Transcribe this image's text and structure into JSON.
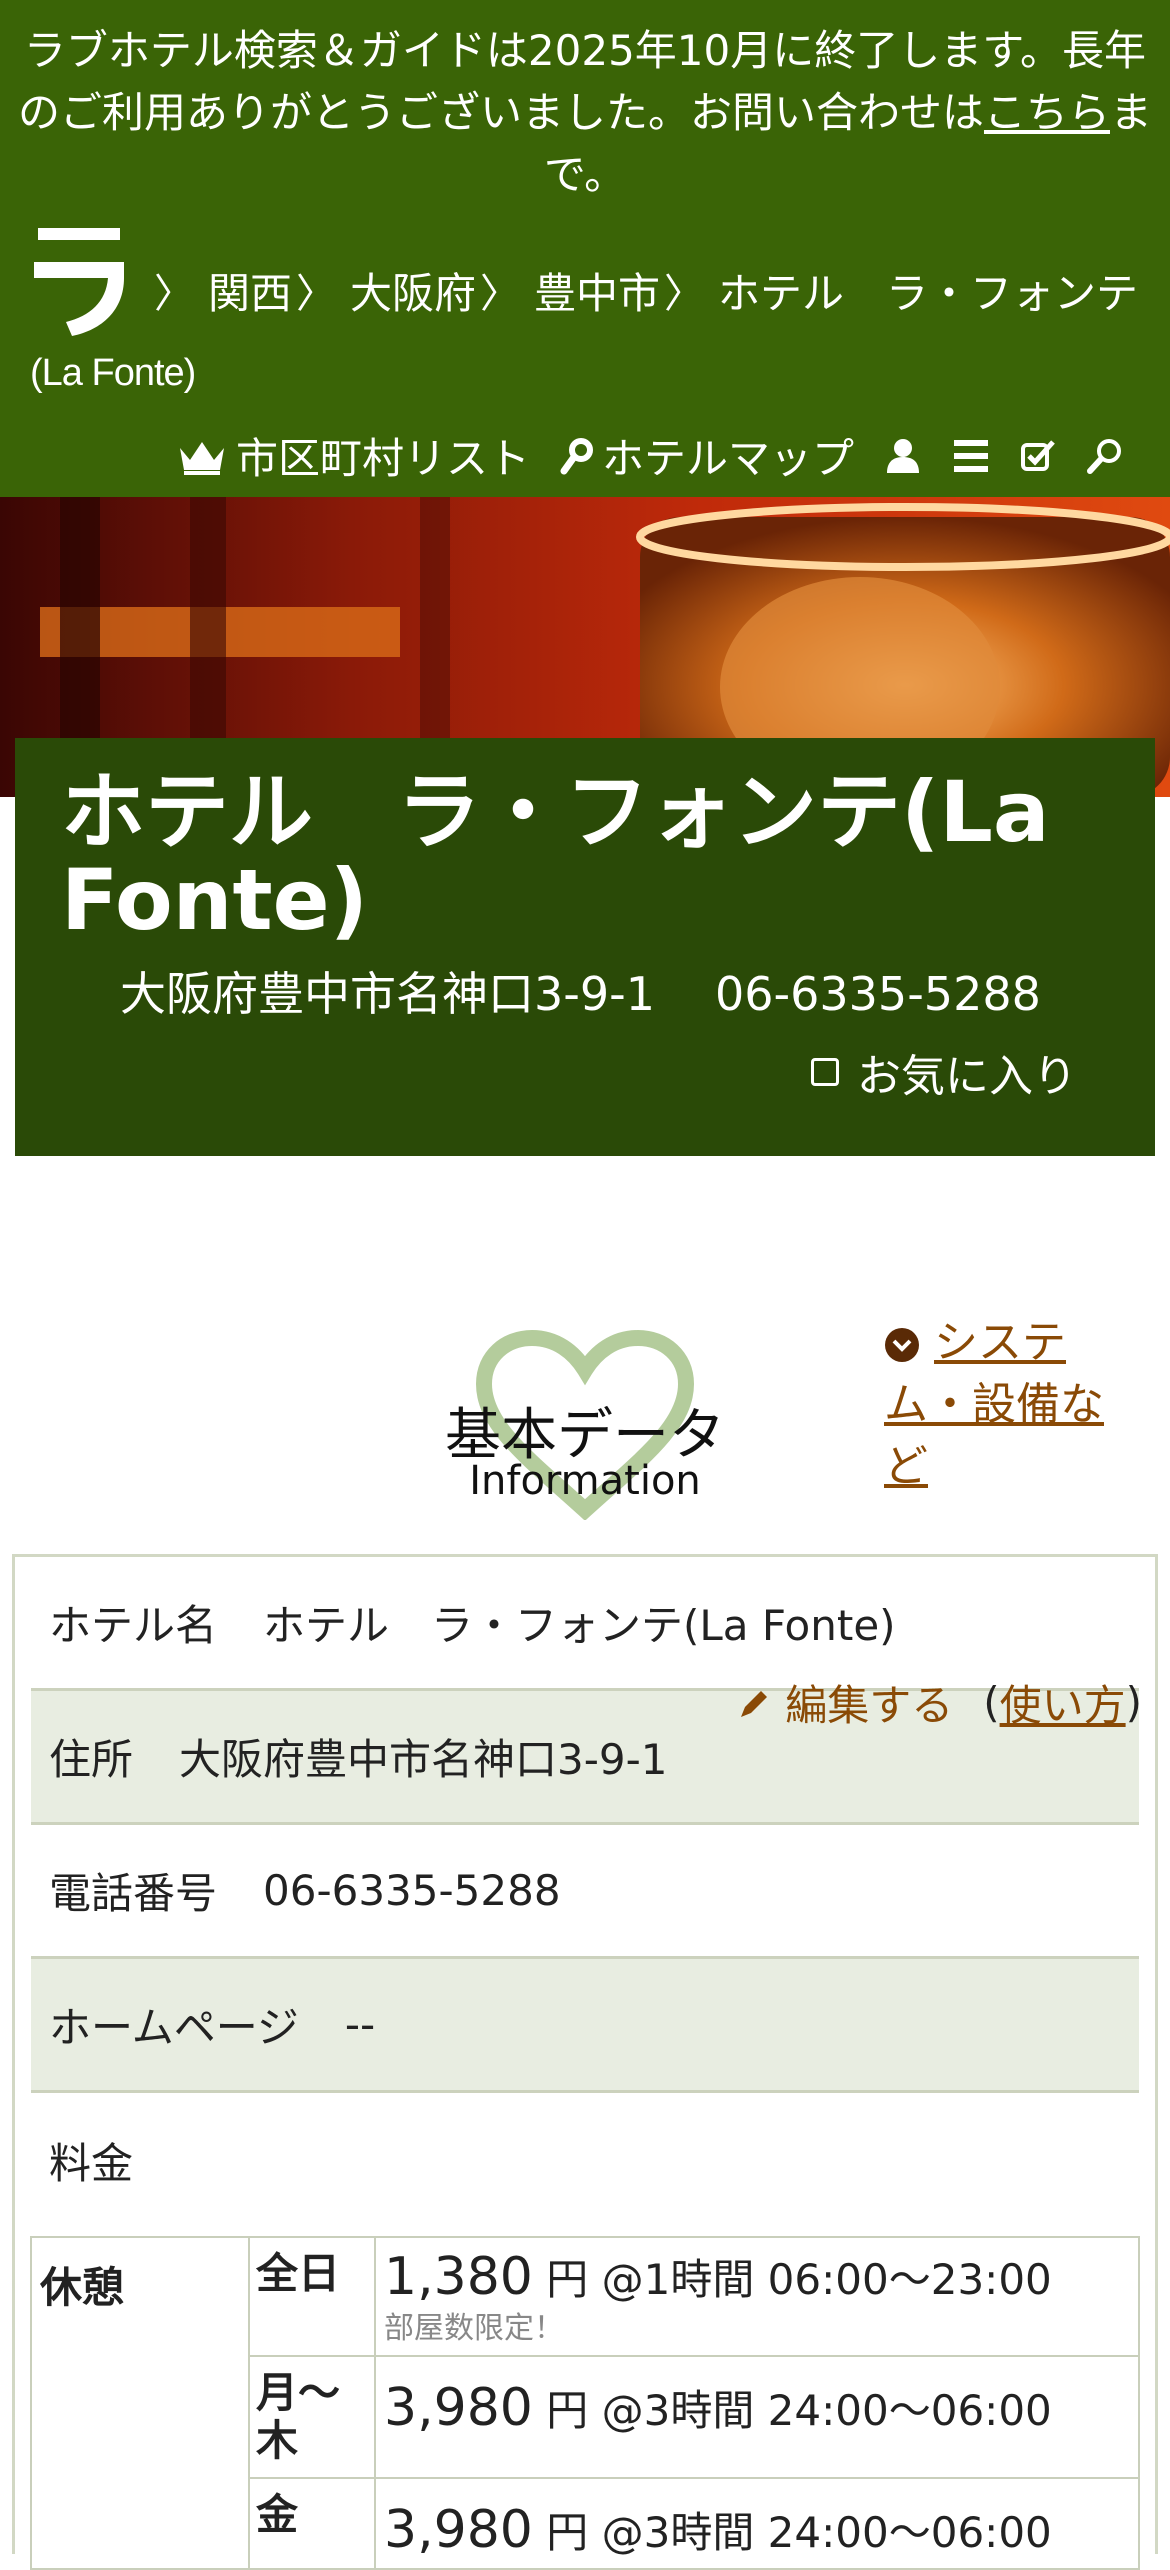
{
  "notice": {
    "text": "ラブホテル検索＆ガイドは2025年10月に終了します。長年のご利用ありがとうございました。お問い合わせは",
    "link": "こちら",
    "suffix": "まで。"
  },
  "logo": {
    "glyph": "ラ",
    "text": "(La Fonte)"
  },
  "breadcrumb": [
    {
      "label": "関西"
    },
    {
      "label": "大阪府"
    },
    {
      "label": "豊中市"
    },
    {
      "label": "ホテル　ラ・フォンテ"
    }
  ],
  "toolbar": {
    "city_list": "市区町村リスト",
    "hotel_map": "ホテルマップ"
  },
  "hotel": {
    "title": "ホテル　ラ・フォンテ(La Fonte)",
    "address": "大阪府豊中市名神口3-9-1",
    "tel": "06-6335-5288",
    "favorite": "お気に入り"
  },
  "section": {
    "title_jp": "基本データ",
    "title_en": "Information",
    "system_link": "システム・設備など"
  },
  "edit": {
    "label": "編集する",
    "help": "使い方"
  },
  "rows": [
    {
      "key": "ホテル名",
      "value": "ホテル　ラ・フォンテ(La Fonte)"
    },
    {
      "key": "住所",
      "value": "大阪府豊中市名神口3-9-1"
    },
    {
      "key": "電話番号",
      "value": "06-6335-5288"
    },
    {
      "key": "ホームページ",
      "value": "--"
    },
    {
      "key": "料金",
      "value": ""
    }
  ],
  "prices": {
    "category": "休憩",
    "items": [
      {
        "day": "全日",
        "amount": "1,380",
        "unit": "円",
        "detail": "@1時間 06:00〜23:00",
        "note": "部屋数限定！"
      },
      {
        "day": "月〜木",
        "amount": "3,980",
        "unit": "円",
        "detail": "@3時間 24:00〜06:00",
        "note": ""
      },
      {
        "day": "金",
        "amount": "3,980",
        "unit": "円",
        "detail": "@3時間 24:00〜06:00",
        "note": ""
      }
    ]
  },
  "colors": {
    "header_green": "#3a6406",
    "card_green": "#2a4a07",
    "link_brown": "#8a4a06",
    "row_alt": "#e8ede1"
  }
}
